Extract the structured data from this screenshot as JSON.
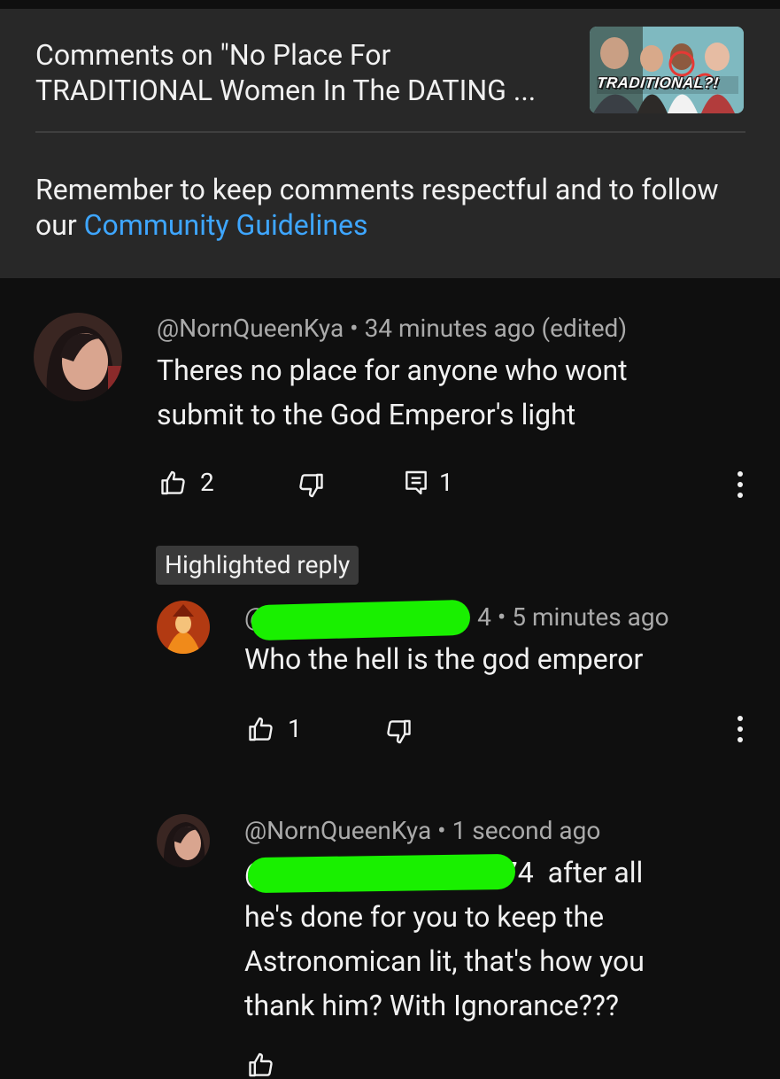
{
  "header": {
    "title": "Comments on \"No Place For\nTRADITIONAL Women In The DATING ...",
    "thumbnail_text": "TRADITIONAL?!",
    "notice_prefix": "Remember to keep comments respectful and to follow our ",
    "notice_link": "Community Guidelines"
  },
  "comment": {
    "author": "@NornQueenKya",
    "time": "34 minutes ago (edited)",
    "text": "Theres no place for anyone who wont submit to the God Emperor's light",
    "likes": "2",
    "replies": "1"
  },
  "highlight_badge": "Highlighted reply",
  "reply1": {
    "author_visible_start": "@",
    "author_visible_end": "4",
    "time": "5 minutes ago",
    "text": "Who the hell is the god emperor",
    "likes": "1"
  },
  "reply2": {
    "author": "@NornQueenKya",
    "time": "1 second ago",
    "mention_visible_start": "@",
    "mention_visible_end": "74",
    "text": "after all he's done for you to keep the Astronomican lit, that's how you thank him? With Ignorance???"
  },
  "colors": {
    "background": "#0f0f0f",
    "header_bg": "#282828",
    "link": "#3ea6ff",
    "redaction": "#19f000",
    "secondary_text": "#aaaaaa"
  },
  "icons": [
    "like-icon",
    "dislike-icon",
    "reply-icon",
    "more-icon"
  ]
}
